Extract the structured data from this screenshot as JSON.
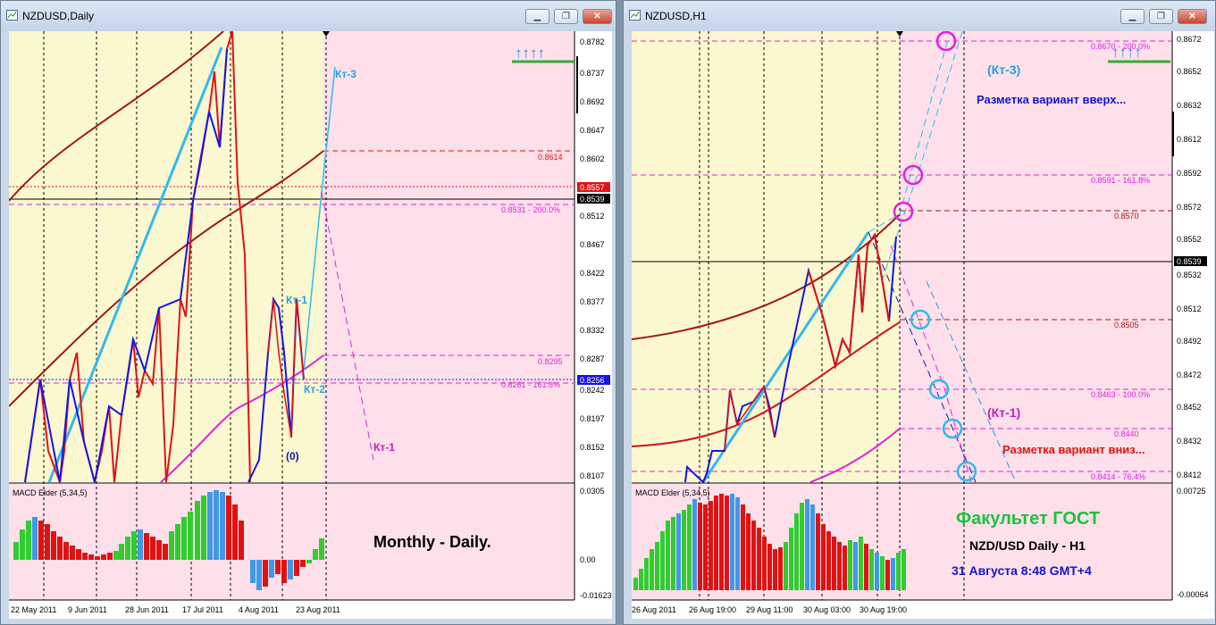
{
  "left": {
    "title": "NZDUSD,Daily",
    "price_labels": [
      "0.8782",
      "0.8737",
      "0.8692",
      "0.8647",
      "0.8602",
      "0.8557",
      "0.8539",
      "0.8512",
      "0.8467",
      "0.8422",
      "0.8377",
      "0.8332",
      "0.8287",
      "0.8256",
      "0.8242",
      "0.8197",
      "0.8152",
      "0.8107"
    ],
    "level_labels": {
      "l8614": "0.8614",
      "l8531": "0.8531 - 200.0%",
      "l8295": "0.8295",
      "l8261": "0.8261 - 161.8%"
    },
    "wave_labels": {
      "kt3": "Кт-3",
      "kt1_top": "Кт-1",
      "kt2": "Кт-2",
      "zero": "(0)",
      "kt1_bottom": "Кт-1"
    },
    "indicator": {
      "name": "MACD Elder (5,34,5)",
      "max": "0.0305",
      "zero": "0.00",
      "min": "-0.01623"
    },
    "caption": "Monthly - Daily.",
    "date_labels": [
      "22 May 2011",
      "9 Jun 2011",
      "28 Jun 2011",
      "17 Jul 2011",
      "4 Aug 2011",
      "23 Aug 2011"
    ],
    "arrows": "↑↑↑↑"
  },
  "right": {
    "title": "NZDUSD,H1",
    "price_labels": [
      "0.8672",
      "0.8652",
      "0.8632",
      "0.8612",
      "0.8592",
      "0.8572",
      "0.8552",
      "0.8539",
      "0.8532",
      "0.8512",
      "0.8492",
      "0.8472",
      "0.8452",
      "0.8432",
      "0.8412"
    ],
    "level_labels": {
      "l8670": "0.8670 - 200.0%",
      "l8591": "0.8591 - 161.8%",
      "l8570": "0.8570",
      "l8505": "0.8505",
      "l8463": "0.8463 - 100.0%",
      "l8440": "0.8440",
      "l8414": "0.8414 - 76.4%"
    },
    "annotations": {
      "kt3": "(Кт-3)",
      "up": "Разметка вариант вверх...",
      "kt1": "(Кт-1)",
      "down": "Разметка вариант вниз..."
    },
    "indicator": {
      "name": "MACD Elder (5,34,5)",
      "max": "0.00725",
      "min": "-0.00064"
    },
    "captions": {
      "faculty": "Факультет ГОСТ",
      "pair": "NZD/USD Daily - H1",
      "date": "31 Августа 8:48 GMT+4"
    },
    "date_labels": [
      "26 Aug 2011",
      "26 Aug 19:00",
      "29 Aug 11:00",
      "30 Aug 03:00",
      "30 Aug 19:00"
    ],
    "arrows": "↑↑↑↑"
  },
  "colors": {
    "bg_yellow": "#fbf8d0",
    "bg_pink": "#fde0ea",
    "blue": "#1515e6",
    "red": "#e01212",
    "cyan": "#33b8ee",
    "magenta": "#e020e0",
    "darkred": "#a01818",
    "green": "#30cc30",
    "hist_blue": "#4098e8"
  }
}
